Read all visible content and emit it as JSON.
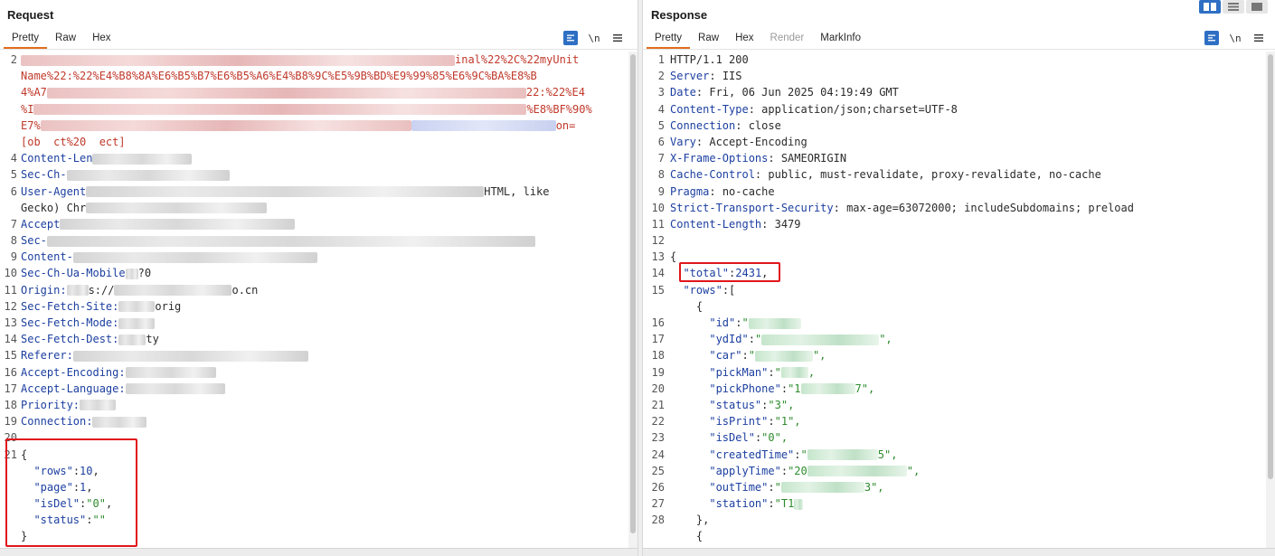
{
  "request": {
    "title": "Request",
    "tabs": [
      "Pretty",
      "Raw",
      "Hex"
    ],
    "active_tab": "Pretty",
    "toolbar": {
      "newline_label": "\\n",
      "menu_icon": "hamburger-icon"
    },
    "line_numbers": [
      "2",
      "",
      "",
      "",
      "",
      "",
      "",
      "",
      "4",
      "5",
      "6",
      "",
      "7",
      "8",
      "9",
      "10",
      "11",
      "12",
      "13",
      "14",
      "15",
      "16",
      "17",
      "18",
      "19",
      "20",
      "21",
      "",
      "",
      "",
      "",
      ""
    ],
    "visible_fragments": {
      "l2_suffix": "inal%22%2C%22myUnit",
      "l2b": "Name%22:%22%E4%B8%8A%E6%B5%B7%E6%B5%A6%E4%B8%9C%E5%9B%BD%E9%99%85%E6%9C%BA%E8%B",
      "l2c_a": "4%A7",
      "l2c_b": "22:%22%E4",
      "l2d_a": "%I",
      "l2d_b": "%E8%BF%90%",
      "l2e_a": "E7%",
      "l2e_b": "on=",
      "l2f": "[ob  ct%20  ect]",
      "l4": "Content-Len",
      "l5": "Sec-Ch-",
      "l6": "User-Agent",
      "l6_tail": "HTML, like",
      "l6b": "Gecko) Chr",
      "l7": "Accept",
      "l8": "Sec-",
      "l9": "Content-",
      "l10": "Sec-Ch-Ua-Mobile",
      "l10_tail": "?0",
      "l11": "Origin:",
      "l11_tail": "s://",
      "l11_end": "o.cn",
      "l12": "Sec-Fetch-Site:",
      "l12_tail": "orig",
      "l13": "Sec-Fetch-Mode:",
      "l14": "Sec-Fetch-Dest:",
      "l14_tail": "ty",
      "l15": "Referer:",
      "l16": "Accept-Encoding:",
      "l17": "Accept-Language:",
      "l18": "Priority:",
      "l19": "Connection:"
    },
    "body": {
      "open": "{",
      "rows_key": "\"rows\"",
      "rows_val": "10",
      "page_key": "\"page\"",
      "page_val": "1",
      "isDel_key": "\"isDel\"",
      "isDel_val": "\"0\"",
      "status_key": "\"status\"",
      "status_val": "\"\"",
      "close": "}"
    }
  },
  "response": {
    "title": "Response",
    "tabs": [
      "Pretty",
      "Raw",
      "Hex",
      "Render",
      "MarkInfo"
    ],
    "active_tab": "Pretty",
    "disabled_tab": "Render",
    "toolbar": {
      "newline_label": "\\n",
      "menu_icon": "hamburger-icon"
    },
    "headers": [
      {
        "n": "1",
        "name": "HTTP/1.1 200",
        "value": ""
      },
      {
        "n": "2",
        "name": "Server",
        "value": "IIS"
      },
      {
        "n": "3",
        "name": "Date",
        "value": "Fri, 06 Jun 2025 04:19:49 GMT"
      },
      {
        "n": "4",
        "name": "Content-Type",
        "value": "application/json;charset=UTF-8"
      },
      {
        "n": "5",
        "name": "Connection",
        "value": "close"
      },
      {
        "n": "6",
        "name": "Vary",
        "value": "Accept-Encoding"
      },
      {
        "n": "7",
        "name": "X-Frame-Options",
        "value": "SAMEORIGIN"
      },
      {
        "n": "8",
        "name": "Cache-Control",
        "value": "public, must-revalidate, proxy-revalidate, no-cache"
      },
      {
        "n": "9",
        "name": "Pragma",
        "value": "no-cache"
      },
      {
        "n": "10",
        "name": "Strict-Transport-Security",
        "value": "max-age=63072000; includeSubdomains; preload"
      },
      {
        "n": "11",
        "name": "Content-Length",
        "value": "3479"
      }
    ],
    "json": {
      "total_key": "\"total\"",
      "total_val": "2431",
      "rows_key": "\"rows\"",
      "fields": [
        {
          "n": "16",
          "key": "\"id\"",
          "pre": "\"",
          "post": ""
        },
        {
          "n": "17",
          "key": "\"ydId\"",
          "pre": "\"",
          "post": "\","
        },
        {
          "n": "18",
          "key": "\"car\"",
          "pre": "\"",
          "post": "\","
        },
        {
          "n": "19",
          "key": "\"pickMan\"",
          "pre": "\"",
          "post": ","
        },
        {
          "n": "20",
          "key": "\"pickPhone\"",
          "pre": "\"1",
          "post": "7\","
        },
        {
          "n": "21",
          "key": "\"status\"",
          "pre": "\"3\",",
          "post": ""
        },
        {
          "n": "22",
          "key": "\"isPrint\"",
          "pre": "\"1\",",
          "post": ""
        },
        {
          "n": "23",
          "key": "\"isDel\"",
          "pre": "\"0\",",
          "post": ""
        },
        {
          "n": "24",
          "key": "\"createdTime\"",
          "pre": "\"",
          "post": "5\","
        },
        {
          "n": "25",
          "key": "\"applyTime\"",
          "pre": "\"20",
          "post": "\","
        },
        {
          "n": "26",
          "key": "\"outTime\"",
          "pre": "\"",
          "post": "3\","
        },
        {
          "n": "27",
          "key": "\"station\"",
          "pre": "\"T1",
          "post": ""
        }
      ]
    }
  }
}
